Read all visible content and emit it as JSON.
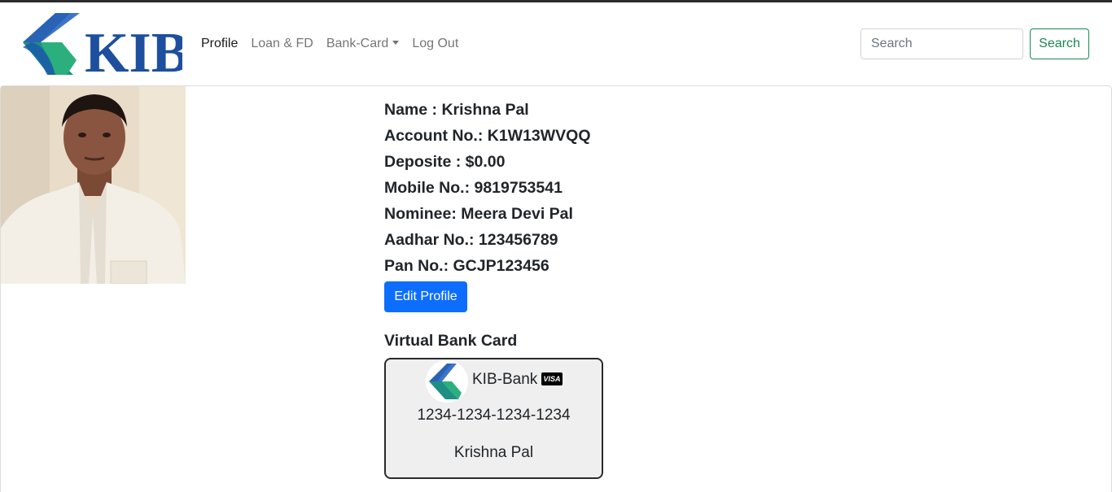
{
  "brand": {
    "logo_text": "KIB",
    "colors": {
      "blue": "#1d4f9e",
      "dark_blue": "#143c7a",
      "teal": "#1f9e77"
    }
  },
  "nav": {
    "items": [
      {
        "label": "Profile",
        "active": true
      },
      {
        "label": "Loan & FD",
        "active": false
      },
      {
        "label": "Bank-Card",
        "active": false,
        "dropdown": true
      },
      {
        "label": "Log Out",
        "active": false
      }
    ]
  },
  "search": {
    "placeholder": "Search",
    "value": "",
    "button_label": "Search"
  },
  "profile": {
    "name": "Name : Krishna Pal",
    "account": "Account No.: K1W13WVQQ",
    "deposit": "Deposite : $0.00",
    "mobile": "Mobile No.: 9819753541",
    "nominee": "Nominee: Meera Devi Pal",
    "aadhar": "Aadhar No.: 123456789",
    "pan": "Pan No.: GCJP123456",
    "edit_label": "Edit Profile"
  },
  "virtual_card": {
    "heading": "Virtual Bank Card",
    "bank_name": "KIB-Bank",
    "network": "VISA",
    "number": "1234-1234-1234-1234",
    "holder": "Krishna Pal"
  },
  "icons": [
    "kib-logo-icon",
    "visa-icon",
    "caret-down-icon"
  ]
}
